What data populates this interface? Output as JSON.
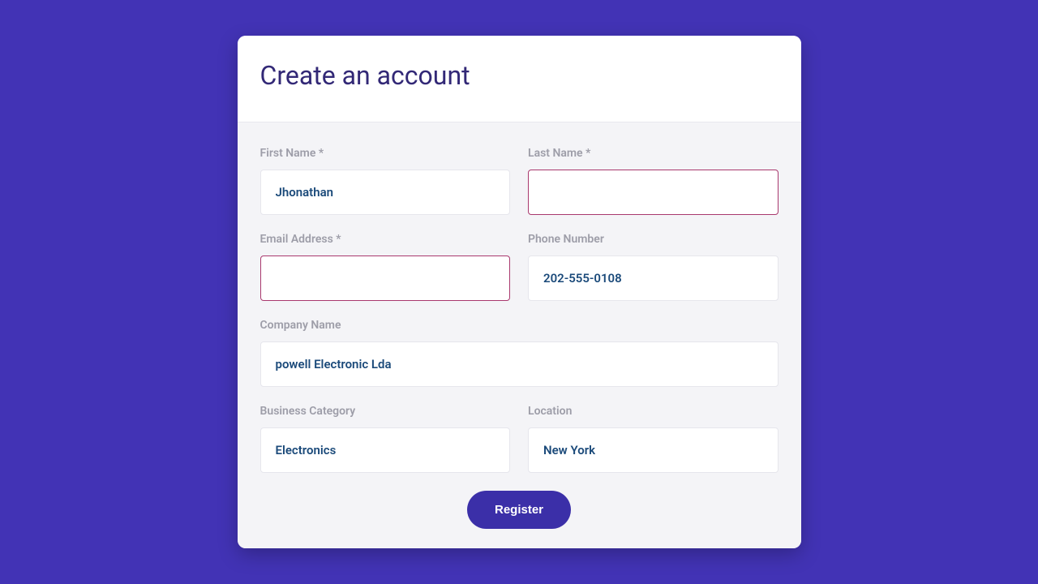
{
  "header": {
    "title": "Create an account"
  },
  "form": {
    "firstName": {
      "label": "First Name *",
      "value": "Jhonathan"
    },
    "lastName": {
      "label": "Last Name *",
      "value": ""
    },
    "email": {
      "label": "Email Address *",
      "value": ""
    },
    "phone": {
      "label": "Phone Number",
      "value": "202-555-0108"
    },
    "company": {
      "label": "Company Name",
      "value": "powell Electronic Lda"
    },
    "category": {
      "label": "Business Category",
      "value": "Electronics"
    },
    "location": {
      "label": "Location",
      "value": "New York"
    },
    "submit": "Register"
  }
}
